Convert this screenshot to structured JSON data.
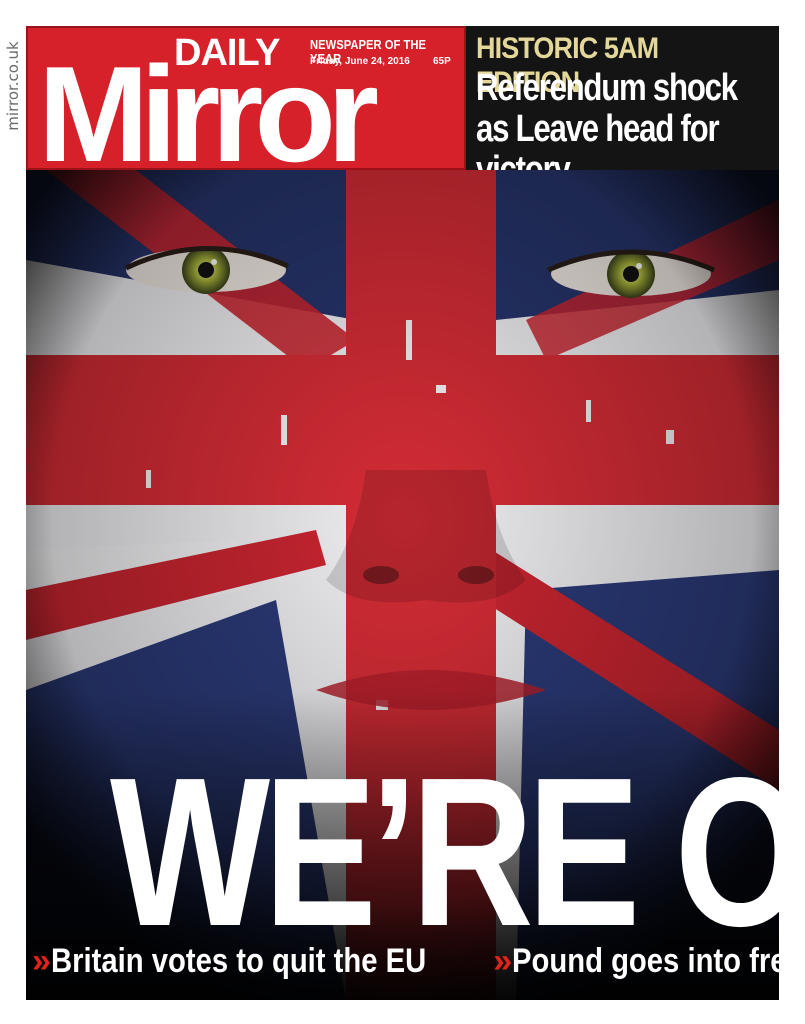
{
  "side_url": "mirror.co.uk",
  "masthead": {
    "daily": "DAILY",
    "mirror": "Mirror",
    "tagline": "NEWSPAPER OF THE YEAR",
    "date": "Friday, June 24, 2016",
    "price": "65P"
  },
  "top_story": {
    "edition": "HISTORIC 5AM EDITION",
    "headline": "Referendum shock as Leave head for victory"
  },
  "main": {
    "headline": "WE’RE OUT",
    "bullets": [
      "Britain votes to quit the EU",
      "Pound goes into freefall"
    ],
    "bullet_marker": "»"
  },
  "colors": {
    "red": "#d6212a",
    "dark": "#141414",
    "edition": "#e4d79a",
    "chevron": "#e2231a",
    "flag_blue": "#26346b"
  }
}
